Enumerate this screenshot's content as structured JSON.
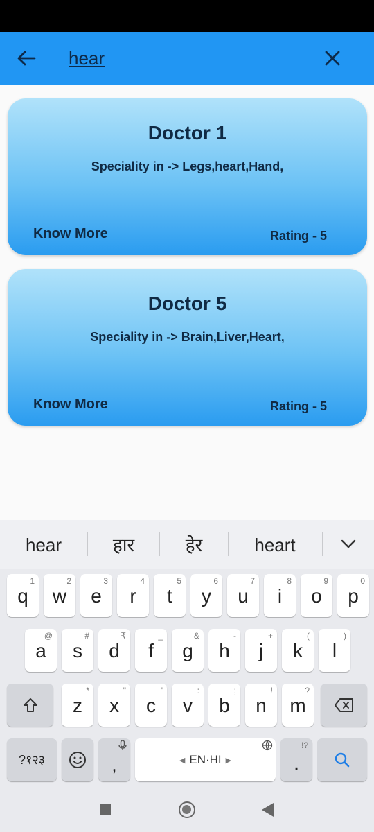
{
  "search": {
    "value": "hear"
  },
  "cards": [
    {
      "title": "Doctor 1",
      "speciality": "Speciality in -> Legs,heart,Hand,",
      "know_more": "Know More",
      "rating": "Rating - 5"
    },
    {
      "title": "Doctor 5",
      "speciality": "Speciality in -> Brain,Liver,Heart,",
      "know_more": "Know More",
      "rating": "Rating - 5"
    }
  ],
  "keyboard": {
    "suggestions": [
      "hear",
      "हार",
      "हेर",
      "heart"
    ],
    "row1": [
      {
        "k": "q",
        "h": "1"
      },
      {
        "k": "w",
        "h": "2"
      },
      {
        "k": "e",
        "h": "3"
      },
      {
        "k": "r",
        "h": "4"
      },
      {
        "k": "t",
        "h": "5"
      },
      {
        "k": "y",
        "h": "6"
      },
      {
        "k": "u",
        "h": "7"
      },
      {
        "k": "i",
        "h": "8"
      },
      {
        "k": "o",
        "h": "9"
      },
      {
        "k": "p",
        "h": "0"
      }
    ],
    "row2": [
      {
        "k": "a",
        "h": "@"
      },
      {
        "k": "s",
        "h": "#"
      },
      {
        "k": "d",
        "h": "₹"
      },
      {
        "k": "f",
        "h": "_"
      },
      {
        "k": "g",
        "h": "&"
      },
      {
        "k": "h",
        "h": "-"
      },
      {
        "k": "j",
        "h": "+"
      },
      {
        "k": "k",
        "h": "("
      },
      {
        "k": "l",
        "h": ")"
      }
    ],
    "row3": [
      {
        "k": "z",
        "h": "*"
      },
      {
        "k": "x",
        "h": "\""
      },
      {
        "k": "c",
        "h": "'"
      },
      {
        "k": "v",
        "h": ":"
      },
      {
        "k": "b",
        "h": ";"
      },
      {
        "k": "n",
        "h": "!"
      },
      {
        "k": "m",
        "h": "?"
      }
    ],
    "symbols_label": "?१२३",
    "comma": ",",
    "space_label": "EN·HI",
    "period": ".",
    "period_hint": "!?"
  },
  "colors": {
    "app_bar": "#2196f3",
    "card_top": "#b0e2fa",
    "card_bottom": "#2a9cf0"
  }
}
